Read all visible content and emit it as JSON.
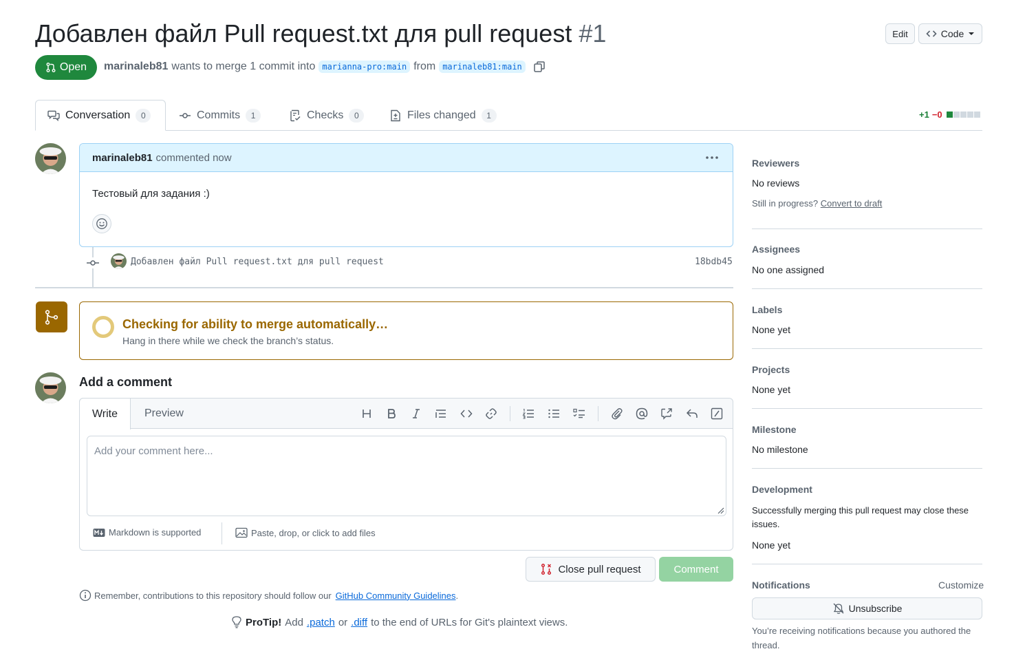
{
  "header": {
    "title": "Добавлен файл Pull request.txt для pull request",
    "number": "#1",
    "edit_label": "Edit",
    "code_label": "Code",
    "state_label": "Open",
    "author": "marinaleb81",
    "merge_text": "wants to merge 1 commit into",
    "base_branch": "marianna-pro:main",
    "from_text": "from",
    "head_branch": "marinaleb81:main"
  },
  "tabs": [
    {
      "label": "Conversation",
      "count": "0"
    },
    {
      "label": "Commits",
      "count": "1"
    },
    {
      "label": "Checks",
      "count": "0"
    },
    {
      "label": "Files changed",
      "count": "1"
    }
  ],
  "diffstat": {
    "additions": "+1",
    "deletions": "−0"
  },
  "comment": {
    "author": "marinaleb81",
    "action": "commented now",
    "body": "Тестовый для задания :)"
  },
  "commit": {
    "message": "Добавлен файл Pull request.txt для pull request",
    "sha": "18bdb45"
  },
  "merge_box": {
    "title": "Checking for ability to merge automatically…",
    "subtitle": "Hang in there while we check the branch’s status."
  },
  "add_comment": {
    "heading": "Add a comment",
    "write_tab": "Write",
    "preview_tab": "Preview",
    "placeholder": "Add your comment here...",
    "markdown_note": "Markdown is supported",
    "files_note": "Paste, drop, or click to add files",
    "close_button": "Close pull request",
    "comment_button": "Comment"
  },
  "footer": {
    "guidelines_prefix": "Remember, contributions to this repository should follow our",
    "guidelines_link": "GitHub Community Guidelines",
    "guidelines_suffix": ".",
    "protip_label": "ProTip!",
    "protip_add": "Add",
    "protip_patch": ".patch",
    "protip_or": "or",
    "protip_diff": ".diff",
    "protip_rest": "to the end of URLs for Git's plaintext views."
  },
  "sidebar": {
    "reviewers_title": "Reviewers",
    "reviewers_value": "No reviews",
    "draft_prefix": "Still in progress?",
    "draft_link": "Convert to draft",
    "assignees_title": "Assignees",
    "assignees_value": "No one assigned",
    "labels_title": "Labels",
    "labels_value": "None yet",
    "projects_title": "Projects",
    "projects_value": "None yet",
    "milestone_title": "Milestone",
    "milestone_value": "No milestone",
    "development_title": "Development",
    "development_text": "Successfully merging this pull request may close these issues.",
    "development_value": "None yet",
    "notifications_title": "Notifications",
    "customize_label": "Customize",
    "unsubscribe_label": "Unsubscribe",
    "notifications_reason": "You’re receiving notifications because you authored the thread."
  },
  "colors": {
    "open_green": "#1f883d",
    "link_blue": "#0969da",
    "merge_pending": "#9a6700",
    "comment_header_bg": "#ddf4ff"
  }
}
